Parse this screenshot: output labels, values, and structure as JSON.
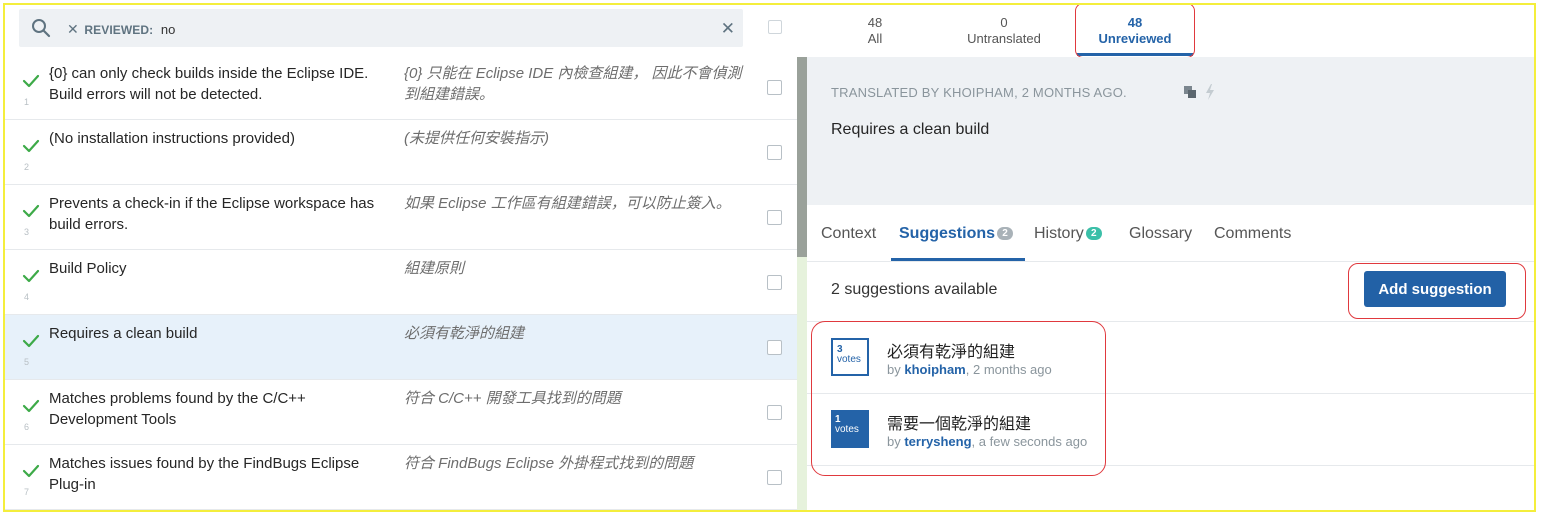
{
  "search": {
    "filter_key": "REVIEWED:",
    "filter_value": "no"
  },
  "rows": [
    {
      "num": "1",
      "source": "{0} can only check builds inside the Eclipse IDE. Build errors will not be detected.",
      "target": "{0} 只能在 Eclipse IDE 內檢查組建， 因此不會偵測到組建錯誤。",
      "selected": false
    },
    {
      "num": "2",
      "source": "(No installation instructions provided)",
      "target": "(未提供任何安裝指示)",
      "selected": false
    },
    {
      "num": "3",
      "source": "Prevents a check-in if the Eclipse workspace has build errors.",
      "target": "如果 Eclipse 工作區有組建錯誤，可以防止簽入。",
      "selected": false
    },
    {
      "num": "4",
      "source": "Build Policy",
      "target": "組建原則",
      "selected": false
    },
    {
      "num": "5",
      "source": "Requires a clean build",
      "target": "必須有乾淨的組建",
      "selected": true
    },
    {
      "num": "6",
      "source": "Matches problems found by the C/C++ Development Tools",
      "target": "符合 C/C++ 開發工具找到的問題",
      "selected": false
    },
    {
      "num": "7",
      "source": "Matches issues found by the FindBugs Eclipse Plug-in",
      "target": "符合 FindBugs Eclipse 外掛程式找到的問題",
      "selected": false
    }
  ],
  "stats": {
    "all": {
      "count": "48",
      "label": "All"
    },
    "untranslated": {
      "count": "0",
      "label": "Untranslated"
    },
    "unreviewed": {
      "count": "48",
      "label": "Unreviewed"
    }
  },
  "detail": {
    "translated_by": "TRANSLATED BY KHOIPHAM, 2 MONTHS AGO.",
    "current_text": "Requires a clean build"
  },
  "tabs": {
    "context": "Context",
    "suggestions": "Suggestions",
    "suggestions_badge": "2",
    "history": "History",
    "history_badge": "2",
    "glossary": "Glossary",
    "comments": "Comments"
  },
  "suggestions": {
    "count_label": "2 suggestions available",
    "add_button": "Add suggestion",
    "items": [
      {
        "votes": "3",
        "votes_label": "votes",
        "text": "必須有乾淨的組建",
        "by": "by ",
        "user": "khoipham",
        "when": ", 2 months ago"
      },
      {
        "votes": "1",
        "votes_label": "votes",
        "text": "需要一個乾淨的組建",
        "by": "by ",
        "user": "terrysheng",
        "when": ", a few seconds ago"
      }
    ]
  },
  "colors": {
    "accent": "#2463a8",
    "annotation": "#e0393e",
    "frame": "#f4ee3c",
    "check": "#3daa48"
  }
}
